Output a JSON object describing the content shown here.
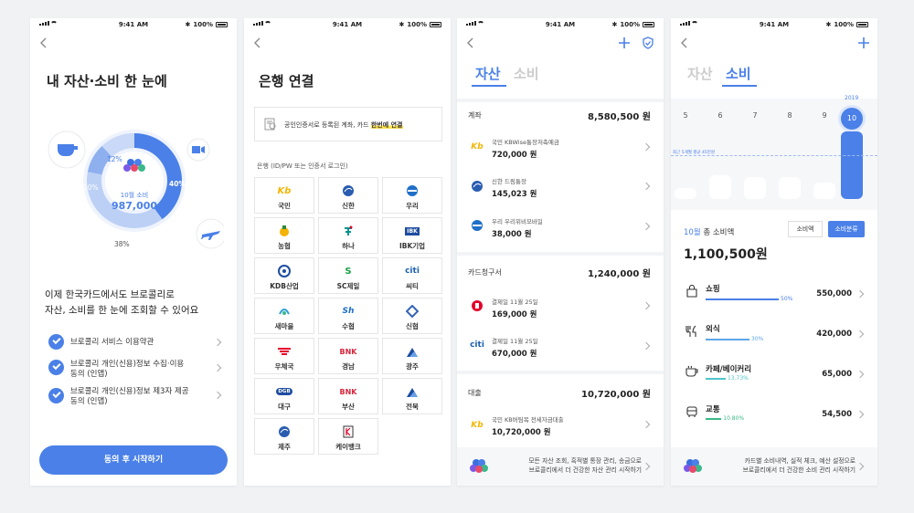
{
  "status": {
    "time": "9:41 AM",
    "battery": "100%"
  },
  "screen1": {
    "title": "내 자산·소비 한 눈에",
    "donut_center_label": "10월 소비",
    "donut_center_value": "987,000",
    "donut_percents": {
      "p40": "40%",
      "p38": "38%",
      "p12": "12%",
      "p10": "10%"
    },
    "donut_values": [
      40,
      38,
      12,
      10
    ],
    "description_line1": "이제 한국카드에서도 브로콜리로",
    "description_line2": "자산, 소비를 한 눈에 조회할 수 있어요",
    "consents": [
      {
        "line1": "브로콜리 서비스 이용약관",
        "line2": ""
      },
      {
        "line1": "브로콜리 개인(신용)정보 수집·이용",
        "line2": "동의 (인앱)"
      },
      {
        "line1": "브로콜리 개인(신용)정보 제3자 제공",
        "line2": "동의 (인앱)"
      }
    ],
    "cta": "동의 후 시작하기",
    "colors": {
      "accent": "#4a80e8",
      "light": "#bcd0f5",
      "mid": "#8fb0ee"
    }
  },
  "screen2": {
    "title": "은행 연결",
    "cert_text_prefix": "공인인증서로 등록된 계좌, 카드 ",
    "cert_text_highlight": "한번에 연결",
    "section_label": "은행 (ID/PW 또는 인증서 로그인)",
    "banks": [
      "국민",
      "신한",
      "우리",
      "농협",
      "하나",
      "IBK기업",
      "KDB산업",
      "SC제일",
      "씨티",
      "새마을",
      "수협",
      "신협",
      "우체국",
      "경남",
      "광주",
      "대구",
      "부산",
      "전북",
      "제주",
      "케이뱅크"
    ],
    "logo_text": {
      "kb": "Kb",
      "sc": "S",
      "citi": "citi",
      "sh": "Sh",
      "bnk": "BNK",
      "dgb": "DGB",
      "ibk": "IBK"
    }
  },
  "screen3": {
    "tab_active": "자산",
    "tab_inactive": "소비",
    "accounts_title": "계좌",
    "accounts_total": "8,580,500 원",
    "accounts": [
      {
        "name": "국민 KBWise통장저축예금",
        "amount": "720,000 원"
      },
      {
        "name": "신한 드림통장",
        "amount": "145,023 원"
      },
      {
        "name": "우리 우리위비모바일",
        "amount": "38,000 원"
      }
    ],
    "cards_title": "카드청구서",
    "cards_total": "1,240,000 원",
    "cards": [
      {
        "name": "결제일 11월 25일",
        "amount": "169,000 원"
      },
      {
        "name": "결제일 11월 25일",
        "amount": "670,000 원"
      }
    ],
    "loans_title": "대출",
    "loans_total": "10,720,000 원",
    "loans": [
      {
        "name": "국민 KB버팀목 전세자금대출",
        "amount": "10,720,000 원"
      }
    ],
    "footer_line1": "모든 자산 조회, 흑적별 통장 관리, 송금으로",
    "footer_line2": "브로콜리에서 더 건강한 자산 관리 시작하기"
  },
  "screen4": {
    "tab_inactive": "자산",
    "tab_active": "소비",
    "year": "2019",
    "months": [
      "5",
      "6",
      "7",
      "8",
      "9",
      "10"
    ],
    "month_values": [
      0.16,
      0.35,
      0.32,
      0.32,
      0.25,
      1.0
    ],
    "avg_label": "최근 5개월 평균 45만원",
    "total_label_prefix": "10월",
    "total_label_suffix": " 총 소비액",
    "toggle_amount": "소비액",
    "toggle_category": "소비분류",
    "total_value": "1,100,500원",
    "categories": [
      {
        "name": "쇼핑",
        "amount": "550,000",
        "pct": "50%",
        "pct_value": 50,
        "color": "#4a80e8"
      },
      {
        "name": "외식",
        "amount": "420,000",
        "pct": "30%",
        "pct_value": 30,
        "color": "#5fa6ea"
      },
      {
        "name": "카페/베이커리",
        "amount": "65,000",
        "pct": "13.73%",
        "pct_value": 13.73,
        "color": "#4fc3c9"
      },
      {
        "name": "교통",
        "amount": "54,500",
        "pct": "10.80%",
        "pct_value": 10.8,
        "color": "#3cb88a"
      }
    ],
    "footer_line1": "카드별 소비내역, 실적 체크, 예산 설정으로",
    "footer_line2": "브로콜리에서 더 건강한 소비 관리 시작하기"
  }
}
